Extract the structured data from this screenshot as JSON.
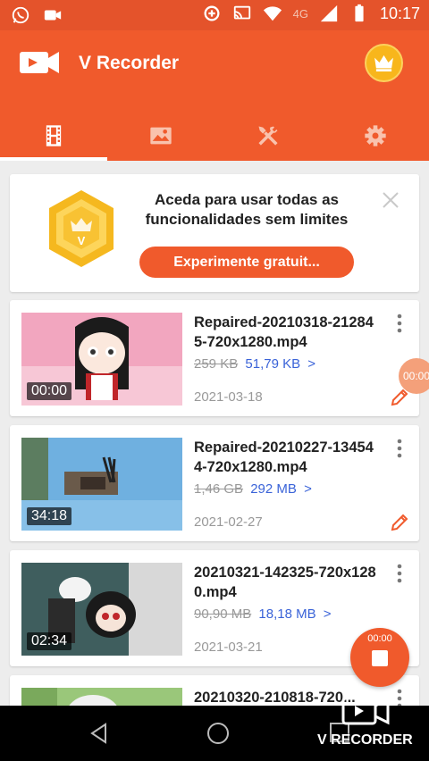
{
  "status_bar": {
    "time": "10:17",
    "network": "4G",
    "icons": [
      "whatsapp-icon",
      "video-camera-icon",
      "data-saver-icon",
      "cast-icon",
      "wifi-icon",
      "signal-icon",
      "battery-icon"
    ]
  },
  "app_bar": {
    "title": "V Recorder",
    "tabs": [
      {
        "icon": "film-icon",
        "active": true
      },
      {
        "icon": "image-icon",
        "active": false
      },
      {
        "icon": "tools-icon",
        "active": false
      },
      {
        "icon": "gear-icon",
        "active": false
      }
    ]
  },
  "promo": {
    "text": "Aceda para usar todas as funcionalidades sem limites",
    "cta_label": "Experimente gratuit...",
    "badge_letter": "V"
  },
  "videos": [
    {
      "name": "Repaired-20210318-212845-720x1280.mp4",
      "old_size": "259 KB",
      "new_size": "51,79 KB",
      "arrow": ">",
      "date": "2021-03-18",
      "duration": "00:00"
    },
    {
      "name": "Repaired-20210227-134544-720x1280.mp4",
      "old_size": "1,46 GB",
      "new_size": "292 MB",
      "arrow": ">",
      "date": "2021-02-27",
      "duration": "34:18"
    },
    {
      "name": "20210321-142325-720x1280.mp4",
      "old_size": "90,90 MB",
      "new_size": "18,18 MB",
      "arrow": ">",
      "date": "2021-03-21",
      "duration": "02:34"
    },
    {
      "name": "20210320-210818-720...",
      "old_size": "",
      "new_size": "",
      "arrow": "",
      "date": "",
      "duration": ""
    }
  ],
  "floating_badge": {
    "time": "00:00"
  },
  "record_button": {
    "timer": "00:00"
  },
  "watermark": {
    "text": "V RECORDER"
  },
  "colors": {
    "primary": "#f05a2c",
    "status_bar": "#e4532b",
    "link": "#3a63d8",
    "crown": "#f8b61c"
  }
}
